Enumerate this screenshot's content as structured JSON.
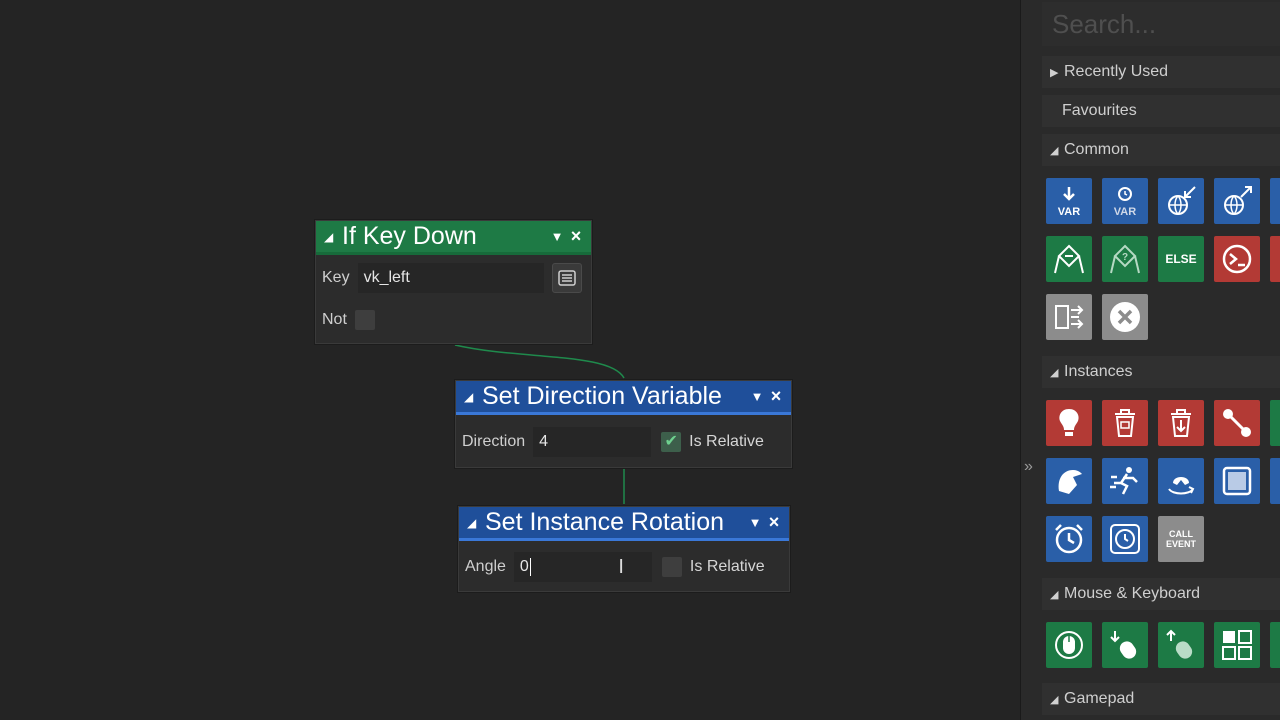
{
  "nodes": {
    "if_key_down": {
      "title": "If Key Down",
      "key_label": "Key",
      "key_value": "vk_left",
      "not_label": "Not"
    },
    "set_direction": {
      "title": "Set Direction Variable",
      "direction_label": "Direction",
      "direction_value": "4",
      "relative_label": "Is Relative",
      "relative_checked": true
    },
    "set_rotation": {
      "title": "Set Instance Rotation",
      "angle_label": "Angle",
      "angle_value": "0",
      "relative_label": "Is Relative",
      "relative_checked": false
    }
  },
  "panel": {
    "search_placeholder": "Search...",
    "sections": {
      "recently_used": "Recently Used",
      "favourites": "Favourites",
      "common": "Common",
      "instances": "Instances",
      "mouse_keyboard": "Mouse & Keyboard",
      "gamepad": "Gamepad"
    },
    "tile_labels": {
      "var": "VAR",
      "else": "ELSE",
      "call_event_1": "CALL",
      "call_event_2": "EVENT"
    }
  },
  "colors": {
    "green_header": "#1e7a45",
    "blue_header": "#1f4f9a",
    "tile_blue": "#2a5fa8",
    "tile_green": "#1d7a45",
    "tile_red": "#b33a35",
    "tile_gray": "#8c8c8c"
  }
}
